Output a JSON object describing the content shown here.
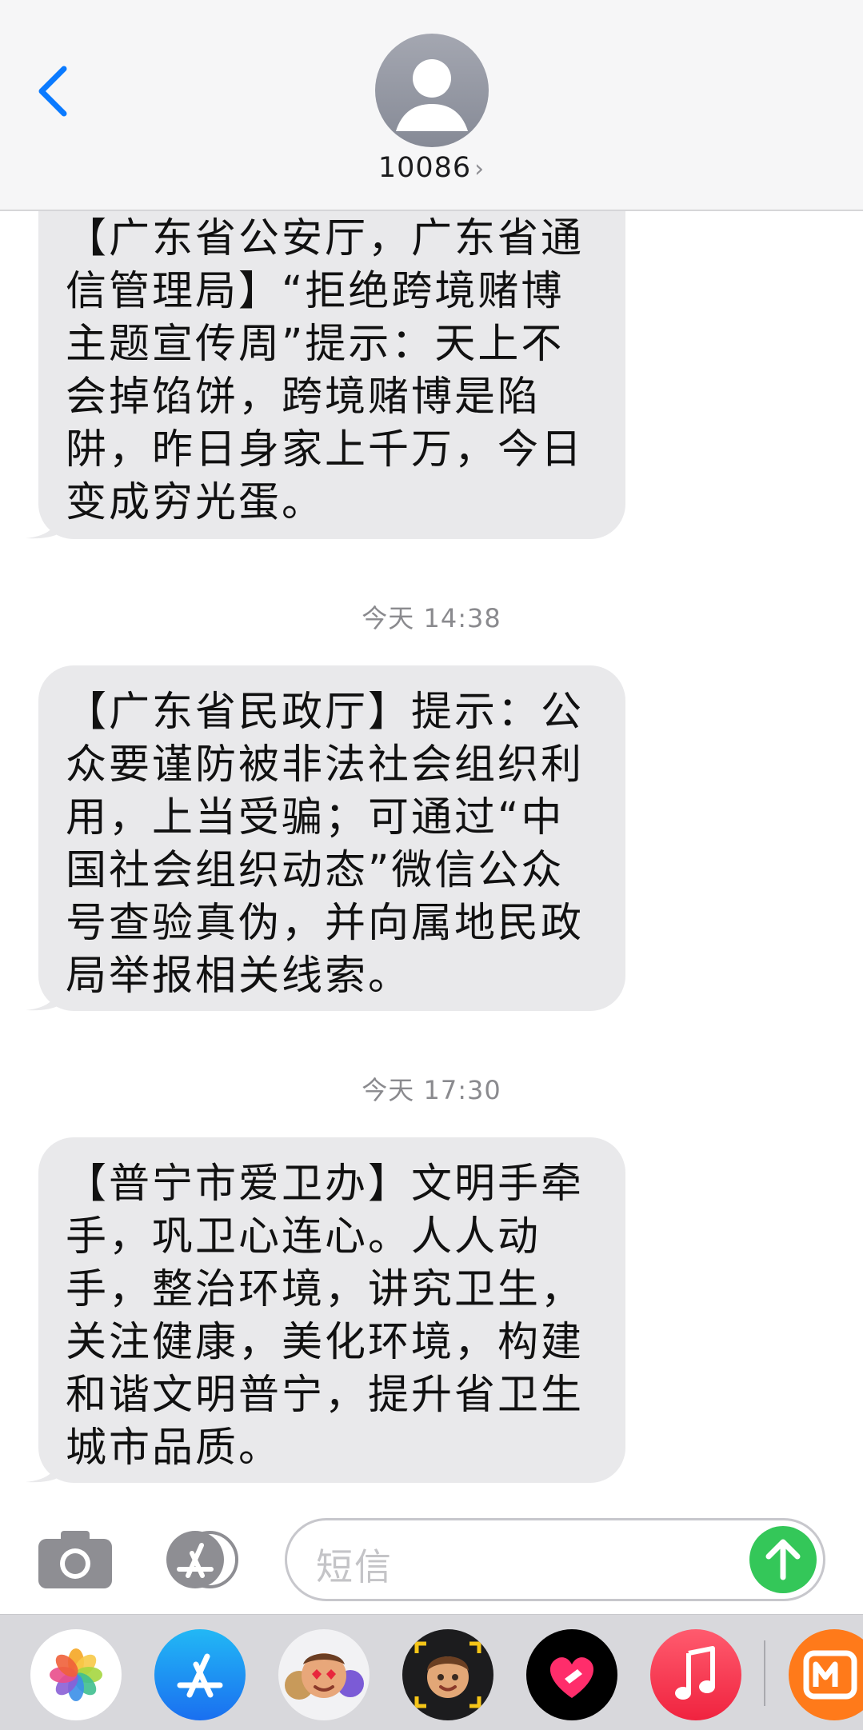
{
  "header": {
    "contact_name": "10086",
    "contact_chevron": "›",
    "back_icon": "chevron-left-icon"
  },
  "messages": [
    {
      "text": "【广东省公安厅，广东省通信管理局】“拒绝跨境赌博主题宣传周”提示：天上不会掉馅饼，跨境赌博是陷阱，昨日身家上千万，今日变成穷光蛋。"
    },
    {
      "text": "【广东省民政厅】提示：公众要谨防被非法社会组织利用，上当受骗；可通过“中国社会组织动态”微信公众号查验真伪，并向属地民政局举报相关线索。"
    },
    {
      "text": "【普宁市爱卫办】文明手牵手，巩卫心连心。人人动手，整治环境，讲究卫生，关注健康，美化环境，构建和谐文明普宁，提升省卫生城市品质。"
    }
  ],
  "timestamps": [
    "今天 14:38",
    "今天 17:30"
  ],
  "input": {
    "placeholder": "短信"
  },
  "colors": {
    "bubble": "#e9e9eb",
    "header_bg": "#f6f6f7",
    "accent_blue": "#0a7aff",
    "send_green": "#34c759"
  },
  "drawer_apps": [
    "photos-app",
    "app-store-app",
    "memoji-stickers-app",
    "memoji-app",
    "digital-touch-app",
    "music-app",
    "mango-tv-app"
  ]
}
